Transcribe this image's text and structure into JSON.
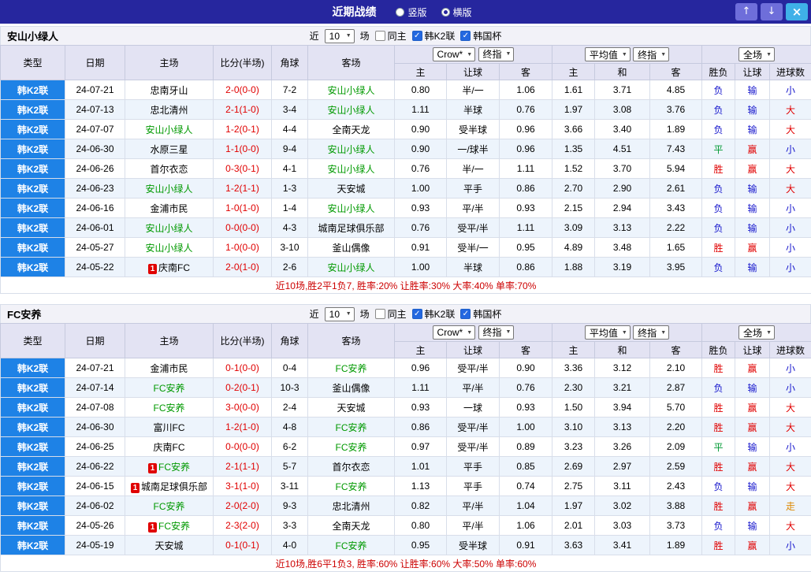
{
  "topbar": {
    "title": "近期战绩",
    "radio_vertical": "竖版",
    "radio_horizontal": "横版",
    "selected": "横版"
  },
  "icons": {
    "up": "↑",
    "down": "↓",
    "close": "×",
    "dropdown": "▼",
    "check": "✓"
  },
  "controls": {
    "near_label": "近",
    "count_value": "10",
    "matches_label": "场",
    "checkbox_same_home": "同主",
    "checkbox_league": "韩K2联",
    "checkbox_cup": "韩国杯"
  },
  "table_header": {
    "type": "类型",
    "date": "日期",
    "home": "主场",
    "score": "比分(半场)",
    "corner": "角球",
    "away": "客场",
    "odds1_select1": "Crow*",
    "odds1_select2": "终指",
    "odds2_select1": "平均值",
    "odds2_select2": "终指",
    "odds3_select": "全场",
    "odds1_cols": [
      "主",
      "让球",
      "客"
    ],
    "odds2_cols": [
      "主",
      "和",
      "客"
    ],
    "result_cols": [
      "胜负",
      "让球",
      "进球数"
    ]
  },
  "colors": {
    "league_bg": "#1E82E6",
    "score": "#E00000",
    "focus": "#009900",
    "win": "#E00000",
    "draw": "#009933",
    "lose": "#1414CC",
    "big": "#E00000",
    "small": "#1414CC",
    "go": "#DD8800"
  },
  "sections": [
    {
      "team": "安山小绿人",
      "summary": "近10场,胜2平1负7, 胜率:20% 让胜率:30% 大率:40% 单率:70%",
      "rows": [
        {
          "league": "韩K2联",
          "date": "24-07-21",
          "home": "忠南牙山",
          "home_focus": false,
          "home_card": "",
          "score": "2-0(0-0)",
          "corner": "7-2",
          "away": "安山小绿人",
          "away_focus": true,
          "away_card": "",
          "o1": [
            "0.80",
            "半/一",
            "1.06"
          ],
          "o2": [
            "1.61",
            "3.71",
            "4.85"
          ],
          "res": [
            "负",
            "输",
            "小"
          ]
        },
        {
          "league": "韩K2联",
          "date": "24-07-13",
          "home": "忠北清州",
          "home_focus": false,
          "home_card": "",
          "score": "2-1(1-0)",
          "corner": "3-4",
          "away": "安山小绿人",
          "away_focus": true,
          "away_card": "",
          "o1": [
            "1.11",
            "半球",
            "0.76"
          ],
          "o2": [
            "1.97",
            "3.08",
            "3.76"
          ],
          "res": [
            "负",
            "输",
            "大"
          ]
        },
        {
          "league": "韩K2联",
          "date": "24-07-07",
          "home": "安山小绿人",
          "home_focus": true,
          "home_card": "",
          "score": "1-2(0-1)",
          "corner": "4-4",
          "away": "全南天龙",
          "away_focus": false,
          "away_card": "",
          "o1": [
            "0.90",
            "受半球",
            "0.96"
          ],
          "o2": [
            "3.66",
            "3.40",
            "1.89"
          ],
          "res": [
            "负",
            "输",
            "大"
          ]
        },
        {
          "league": "韩K2联",
          "date": "24-06-30",
          "home": "水原三星",
          "home_focus": false,
          "home_card": "",
          "score": "1-1(0-0)",
          "corner": "9-4",
          "away": "安山小绿人",
          "away_focus": true,
          "away_card": "",
          "o1": [
            "0.90",
            "一/球半",
            "0.96"
          ],
          "o2": [
            "1.35",
            "4.51",
            "7.43"
          ],
          "res": [
            "平",
            "赢",
            "小"
          ]
        },
        {
          "league": "韩K2联",
          "date": "24-06-26",
          "home": "首尔衣恋",
          "home_focus": false,
          "home_card": "",
          "score": "0-3(0-1)",
          "corner": "4-1",
          "away": "安山小绿人",
          "away_focus": true,
          "away_card": "",
          "o1": [
            "0.76",
            "半/一",
            "1.11"
          ],
          "o2": [
            "1.52",
            "3.70",
            "5.94"
          ],
          "res": [
            "胜",
            "赢",
            "大"
          ]
        },
        {
          "league": "韩K2联",
          "date": "24-06-23",
          "home": "安山小绿人",
          "home_focus": true,
          "home_card": "",
          "score": "1-2(1-1)",
          "corner": "1-3",
          "away": "天安城",
          "away_focus": false,
          "away_card": "",
          "o1": [
            "1.00",
            "平手",
            "0.86"
          ],
          "o2": [
            "2.70",
            "2.90",
            "2.61"
          ],
          "res": [
            "负",
            "输",
            "大"
          ]
        },
        {
          "league": "韩K2联",
          "date": "24-06-16",
          "home": "金浦市民",
          "home_focus": false,
          "home_card": "",
          "score": "1-0(1-0)",
          "corner": "1-4",
          "away": "安山小绿人",
          "away_focus": true,
          "away_card": "",
          "o1": [
            "0.93",
            "平/半",
            "0.93"
          ],
          "o2": [
            "2.15",
            "2.94",
            "3.43"
          ],
          "res": [
            "负",
            "输",
            "小"
          ]
        },
        {
          "league": "韩K2联",
          "date": "24-06-01",
          "home": "安山小绿人",
          "home_focus": true,
          "home_card": "",
          "score": "0-0(0-0)",
          "corner": "4-3",
          "away": "城南足球俱乐部",
          "away_focus": false,
          "away_card": "",
          "o1": [
            "0.76",
            "受平/半",
            "1.11"
          ],
          "o2": [
            "3.09",
            "3.13",
            "2.22"
          ],
          "res": [
            "负",
            "输",
            "小"
          ]
        },
        {
          "league": "韩K2联",
          "date": "24-05-27",
          "home": "安山小绿人",
          "home_focus": true,
          "home_card": "",
          "score": "1-0(0-0)",
          "corner": "3-10",
          "away": "釜山偶像",
          "away_focus": false,
          "away_card": "",
          "o1": [
            "0.91",
            "受半/一",
            "0.95"
          ],
          "o2": [
            "4.89",
            "3.48",
            "1.65"
          ],
          "res": [
            "胜",
            "赢",
            "小"
          ]
        },
        {
          "league": "韩K2联",
          "date": "24-05-22",
          "home": "庆南FC",
          "home_focus": false,
          "home_card": "1",
          "score": "2-0(1-0)",
          "corner": "2-6",
          "away": "安山小绿人",
          "away_focus": true,
          "away_card": "",
          "o1": [
            "1.00",
            "半球",
            "0.86"
          ],
          "o2": [
            "1.88",
            "3.19",
            "3.95"
          ],
          "res": [
            "负",
            "输",
            "小"
          ]
        }
      ]
    },
    {
      "team": "FC安养",
      "summary": "近10场,胜6平1负3, 胜率:60% 让胜率:60% 大率:50% 单率:60%",
      "rows": [
        {
          "league": "韩K2联",
          "date": "24-07-21",
          "home": "金浦市民",
          "home_focus": false,
          "home_card": "",
          "score": "0-1(0-0)",
          "corner": "0-4",
          "away": "FC安养",
          "away_focus": true,
          "away_card": "",
          "o1": [
            "0.96",
            "受平/半",
            "0.90"
          ],
          "o2": [
            "3.36",
            "3.12",
            "2.10"
          ],
          "res": [
            "胜",
            "赢",
            "小"
          ]
        },
        {
          "league": "韩K2联",
          "date": "24-07-14",
          "home": "FC安养",
          "home_focus": true,
          "home_card": "",
          "score": "0-2(0-1)",
          "corner": "10-3",
          "away": "釜山偶像",
          "away_focus": false,
          "away_card": "",
          "o1": [
            "1.11",
            "平/半",
            "0.76"
          ],
          "o2": [
            "2.30",
            "3.21",
            "2.87"
          ],
          "res": [
            "负",
            "输",
            "小"
          ]
        },
        {
          "league": "韩K2联",
          "date": "24-07-08",
          "home": "FC安养",
          "home_focus": true,
          "home_card": "",
          "score": "3-0(0-0)",
          "corner": "2-4",
          "away": "天安城",
          "away_focus": false,
          "away_card": "",
          "o1": [
            "0.93",
            "一球",
            "0.93"
          ],
          "o2": [
            "1.50",
            "3.94",
            "5.70"
          ],
          "res": [
            "胜",
            "赢",
            "大"
          ]
        },
        {
          "league": "韩K2联",
          "date": "24-06-30",
          "home": "富川FC",
          "home_focus": false,
          "home_card": "",
          "score": "1-2(1-0)",
          "corner": "4-8",
          "away": "FC安养",
          "away_focus": true,
          "away_card": "",
          "o1": [
            "0.86",
            "受平/半",
            "1.00"
          ],
          "o2": [
            "3.10",
            "3.13",
            "2.20"
          ],
          "res": [
            "胜",
            "赢",
            "大"
          ]
        },
        {
          "league": "韩K2联",
          "date": "24-06-25",
          "home": "庆南FC",
          "home_focus": false,
          "home_card": "",
          "score": "0-0(0-0)",
          "corner": "6-2",
          "away": "FC安养",
          "away_focus": true,
          "away_card": "",
          "o1": [
            "0.97",
            "受平/半",
            "0.89"
          ],
          "o2": [
            "3.23",
            "3.26",
            "2.09"
          ],
          "res": [
            "平",
            "输",
            "小"
          ]
        },
        {
          "league": "韩K2联",
          "date": "24-06-22",
          "home": "FC安养",
          "home_focus": true,
          "home_card": "1",
          "score": "2-1(1-1)",
          "corner": "5-7",
          "away": "首尔衣恋",
          "away_focus": false,
          "away_card": "",
          "o1": [
            "1.01",
            "平手",
            "0.85"
          ],
          "o2": [
            "2.69",
            "2.97",
            "2.59"
          ],
          "res": [
            "胜",
            "赢",
            "大"
          ]
        },
        {
          "league": "韩K2联",
          "date": "24-06-15",
          "home": "城南足球俱乐部",
          "home_focus": false,
          "home_card": "1",
          "score": "3-1(1-0)",
          "corner": "3-11",
          "away": "FC安养",
          "away_focus": true,
          "away_card": "",
          "o1": [
            "1.13",
            "平手",
            "0.74"
          ],
          "o2": [
            "2.75",
            "3.11",
            "2.43"
          ],
          "res": [
            "负",
            "输",
            "大"
          ]
        },
        {
          "league": "韩K2联",
          "date": "24-06-02",
          "home": "FC安养",
          "home_focus": true,
          "home_card": "",
          "score": "2-0(2-0)",
          "corner": "9-3",
          "away": "忠北清州",
          "away_focus": false,
          "away_card": "",
          "o1": [
            "0.82",
            "平/半",
            "1.04"
          ],
          "o2": [
            "1.97",
            "3.02",
            "3.88"
          ],
          "res": [
            "胜",
            "赢",
            "走"
          ]
        },
        {
          "league": "韩K2联",
          "date": "24-05-26",
          "home": "FC安养",
          "home_focus": true,
          "home_card": "1",
          "score": "2-3(2-0)",
          "corner": "3-3",
          "away": "全南天龙",
          "away_focus": false,
          "away_card": "",
          "o1": [
            "0.80",
            "平/半",
            "1.06"
          ],
          "o2": [
            "2.01",
            "3.03",
            "3.73"
          ],
          "res": [
            "负",
            "输",
            "大"
          ]
        },
        {
          "league": "韩K2联",
          "date": "24-05-19",
          "home": "天安城",
          "home_focus": false,
          "home_card": "",
          "score": "0-1(0-1)",
          "corner": "4-0",
          "away": "FC安养",
          "away_focus": true,
          "away_card": "",
          "o1": [
            "0.95",
            "受半球",
            "0.91"
          ],
          "o2": [
            "3.63",
            "3.41",
            "1.89"
          ],
          "res": [
            "胜",
            "赢",
            "小"
          ]
        }
      ]
    }
  ]
}
